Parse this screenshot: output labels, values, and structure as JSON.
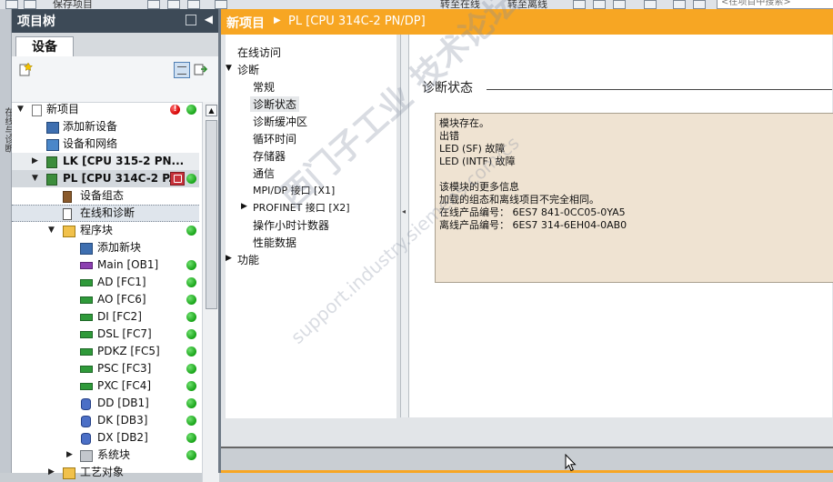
{
  "toolbar": {
    "save_project_label": "保存项目",
    "go_online_label": "转至在线",
    "go_offline_label": "转至离线",
    "search_placeholder": "<在项目中搜索>"
  },
  "vertical_strip": {
    "label": "在线与诊断"
  },
  "tree": {
    "title": "项目树",
    "tab": "设备",
    "items": [
      {
        "label": "新项目"
      },
      {
        "label": "添加新设备"
      },
      {
        "label": "设备和网络"
      },
      {
        "label": "LK [CPU 315-2 PN..."
      },
      {
        "label": "PL [CPU 314C-2 P..."
      },
      {
        "label": "设备组态"
      },
      {
        "label": "在线和诊断"
      },
      {
        "label": "程序块"
      },
      {
        "label": "添加新块"
      },
      {
        "label": "Main [OB1]"
      },
      {
        "label": "AD [FC1]"
      },
      {
        "label": "AO [FC6]"
      },
      {
        "label": "DI [FC2]"
      },
      {
        "label": "DSL [FC7]"
      },
      {
        "label": "PDKZ [FC5]"
      },
      {
        "label": "PSC [FC3]"
      },
      {
        "label": "PXC [FC4]"
      },
      {
        "label": "DD [DB1]"
      },
      {
        "label": "DK [DB3]"
      },
      {
        "label": "DX [DB2]"
      },
      {
        "label": "系统块"
      },
      {
        "label": "工艺对象"
      }
    ],
    "error_badge": "!"
  },
  "editor": {
    "breadcrumb_project": "新项目",
    "breadcrumb_device": "PL [CPU 314C-2 PN/DP]",
    "nav": {
      "online_access": "在线访问",
      "diagnostics": "诊断",
      "general": "常规",
      "diag_status": "诊断状态",
      "diag_buffer": "诊断缓冲区",
      "cycle_time": "循环时间",
      "memory": "存储器",
      "communication": "通信",
      "mpi_dp": "MPI/DP 接口 [X1]",
      "profinet": "PROFINET 接口 [X2]",
      "op_hours": "操作小时计数器",
      "performance": "性能数据",
      "functions": "功能"
    },
    "section_title": "诊断状态",
    "diag_lines": [
      "模块存在。",
      "出错",
      "LED (SF) 故障",
      "LED (INTF) 故障",
      "",
      "该模块的更多信息",
      "加载的组态和离线项目不完全相同。",
      "在线产品编号：  6ES7 841-0CC05-0YA5",
      "离线产品编号：  6ES7 314-6EH04-0AB0"
    ]
  },
  "watermark": {
    "line1": "西门子工业 技术论坛",
    "line2": "support.industry.siemens.com/cs"
  }
}
